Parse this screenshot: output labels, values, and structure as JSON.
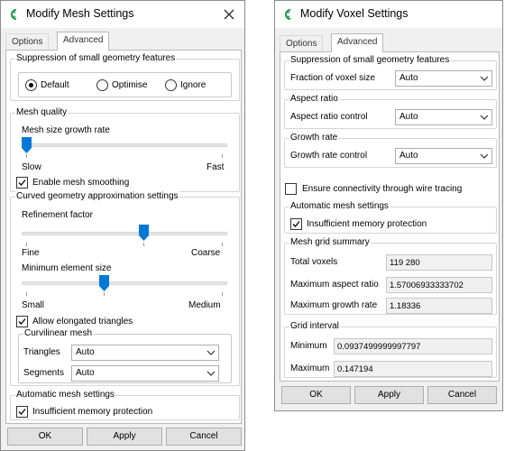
{
  "left": {
    "title": "Modify Mesh Settings",
    "tabs": [
      "Options",
      "Advanced"
    ],
    "suppression": {
      "title": "Suppression of small geometry features",
      "options": [
        "Default",
        "Optimise",
        "Ignore"
      ],
      "selected": "Default"
    },
    "mesh_quality": {
      "title": "Mesh quality",
      "growth_label": "Mesh size growth rate",
      "growth_min_label": "Slow",
      "growth_max_label": "Fast",
      "growth_position": 0.0,
      "smoothing_label": "Enable mesh smoothing",
      "smoothing_checked": true
    },
    "curved": {
      "title": "Curved geometry approximation settings",
      "refinement_label": "Refinement factor",
      "refinement_min_label": "Fine",
      "refinement_max_label": "Coarse",
      "refinement_position": 0.6,
      "min_elem_label": "Minimum element size",
      "min_elem_min_label": "Small",
      "min_elem_max_label": "Medium",
      "min_elem_position": 0.4,
      "elongated_label": "Allow elongated triangles",
      "elongated_checked": true,
      "curvilinear": {
        "title": "Curvilinear mesh",
        "triangles_label": "Triangles",
        "triangles_value": "Auto",
        "segments_label": "Segments",
        "segments_value": "Auto"
      }
    },
    "auto_mesh": {
      "title": "Automatic mesh settings",
      "insufficient_label": "Insufficient memory protection",
      "insufficient_checked": true
    },
    "buttons": {
      "ok": "OK",
      "apply": "Apply",
      "cancel": "Cancel"
    }
  },
  "right": {
    "title": "Modify Voxel Settings",
    "tabs": [
      "Options",
      "Advanced"
    ],
    "suppression": {
      "title": "Suppression of small geometry features",
      "fraction_label": "Fraction of voxel size",
      "fraction_value": "Auto"
    },
    "aspect": {
      "title": "Aspect ratio",
      "control_label": "Aspect ratio control",
      "control_value": "Auto"
    },
    "growth": {
      "title": "Growth rate",
      "control_label": "Growth rate control",
      "control_value": "Auto"
    },
    "connectivity": {
      "label": "Ensure connectivity through wire tracing",
      "checked": false
    },
    "auto_mesh": {
      "title": "Automatic mesh settings",
      "insufficient_label": "Insufficient memory protection",
      "insufficient_checked": true
    },
    "summary": {
      "title": "Mesh grid summary",
      "total_label": "Total voxels",
      "total_value": "119 280",
      "max_aspect_label": "Maximum aspect ratio",
      "max_aspect_value": "1.57006933333702",
      "max_growth_label": "Maximum growth rate",
      "max_growth_value": "1.18336"
    },
    "grid_interval": {
      "title": "Grid interval",
      "minimum_label": "Minimum",
      "minimum_value": "0.0937499999997797",
      "maximum_label": "Maximum",
      "maximum_value": "0.147194"
    },
    "buttons": {
      "ok": "OK",
      "apply": "Apply",
      "cancel": "Cancel"
    }
  },
  "colors": {
    "accent": "#0078d7",
    "icon_green": "#2e9e5b"
  }
}
